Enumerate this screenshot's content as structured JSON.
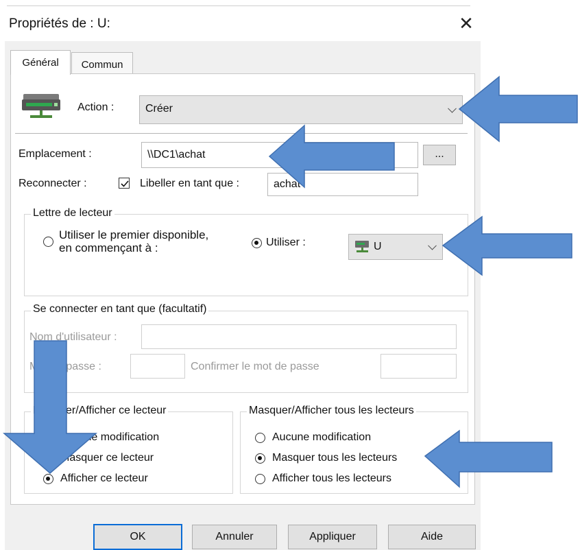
{
  "window": {
    "title": "Propriétés de : U:",
    "close_symbol": "✕"
  },
  "tabs": [
    {
      "label": "Général",
      "active": true
    },
    {
      "label": "Commun",
      "active": false
    }
  ],
  "action": {
    "label": "Action :",
    "value": "Créer"
  },
  "location": {
    "label": "Emplacement :",
    "value": "\\\\DC1\\achat",
    "browse_label": "..."
  },
  "reconnect": {
    "label": "Reconnecter :",
    "checked": true,
    "label_as": "Libeller en tant que :",
    "label_as_value": "achat"
  },
  "drive_letter": {
    "legend": "Lettre de lecteur",
    "option_first_line1": "Utiliser le premier disponible,",
    "option_first_line2": "en commençant à :",
    "option_use": "Utiliser :",
    "selected_letter": "U"
  },
  "connect_as": {
    "legend": "Se connecter en tant que (facultatif)",
    "username_label": "Nom d'utilisateur :",
    "password_label": "Mot de passe :",
    "confirm_label": "Confirmer le mot de passe"
  },
  "hide_this": {
    "legend": "Masquer/Afficher ce lecteur",
    "options": [
      "Aucune modification",
      "Masquer ce lecteur",
      "Afficher ce lecteur"
    ],
    "selected": 2
  },
  "hide_all": {
    "legend": "Masquer/Afficher tous les lecteurs",
    "options": [
      "Aucune modification",
      "Masquer tous les lecteurs",
      "Afficher tous les lecteurs"
    ],
    "selected": 1
  },
  "buttons": {
    "ok": "OK",
    "cancel": "Annuler",
    "apply": "Appliquer",
    "help": "Aide"
  },
  "colors": {
    "arrow": "#5b8ed0",
    "arrow_stroke": "#3f6fb0",
    "focus": "#0a6cd6"
  }
}
